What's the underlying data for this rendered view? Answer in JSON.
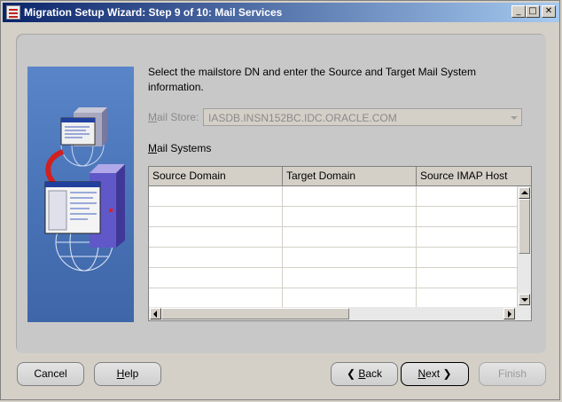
{
  "window": {
    "title": "Migration Setup Wizard:  Step 9 of 10: Mail Services",
    "controls": {
      "minimize": "_",
      "maximize": "□",
      "close": "✕"
    }
  },
  "content": {
    "instruction_line1": "Select the mailstore DN and enter the Source and Target Mail System",
    "instruction_line2": "information.",
    "mailstore": {
      "label_mnemonic": "M",
      "label_rest": "ail Store:",
      "value": "IASDB.INSN152BC.IDC.ORACLE.COM",
      "enabled": false
    },
    "mail_systems_label_mnemonic": "M",
    "mail_systems_label_rest": "ail Systems",
    "table": {
      "columns": [
        "Source Domain",
        "Target Domain",
        "Source IMAP Host"
      ],
      "rows": [
        [
          "",
          "",
          ""
        ],
        [
          "",
          "",
          ""
        ],
        [
          "",
          "",
          ""
        ],
        [
          "",
          "",
          ""
        ],
        [
          "",
          "",
          ""
        ],
        [
          "",
          "",
          ""
        ]
      ]
    }
  },
  "buttons": {
    "cancel": "Cancel",
    "help_mnemonic": "H",
    "help_rest": "elp",
    "back_mnemonic": "B",
    "back_rest": "ack",
    "next_mnemonic": "N",
    "next_rest": "ext",
    "finish": "Finish"
  },
  "colors": {
    "titlebar_start": "#0a246a",
    "titlebar_end": "#a6caf0",
    "panel_bg": "#c8c8c8",
    "illustration_bg": "#4a74b8"
  }
}
